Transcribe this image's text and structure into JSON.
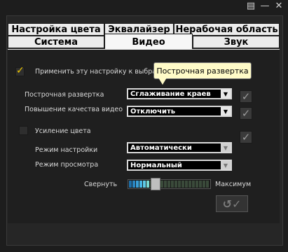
{
  "window": {
    "icons": [
      "notes-icon",
      "minimize-icon",
      "close-icon"
    ]
  },
  "tabs": {
    "row1": [
      "Настройка цвета",
      "Эквалайзер",
      "Нерабочая область"
    ],
    "row2": [
      "Система",
      "Видео",
      "Звук"
    ],
    "active": "Видео"
  },
  "video": {
    "apply_setting_label": "Применить эту настройку к выбранному",
    "progressive_scan_label": "Построчная развертка",
    "progressive_scan_value": "Сглаживание краев",
    "enhance_quality_label": "Повышение качества видео",
    "enhance_quality_value": "Отключить",
    "color_boost_label": "Усиление цвета",
    "tuning_mode_label": "Режим настройки",
    "tuning_mode_value": "Автоматически",
    "view_mode_label": "Режим просмотра",
    "view_mode_value": "Нормальный",
    "slider_min_label": "Свернуть",
    "slider_max_label": "Максимум",
    "slider_level_fraction": 0.28
  },
  "tooltip": {
    "text": "Построчная развертка"
  }
}
